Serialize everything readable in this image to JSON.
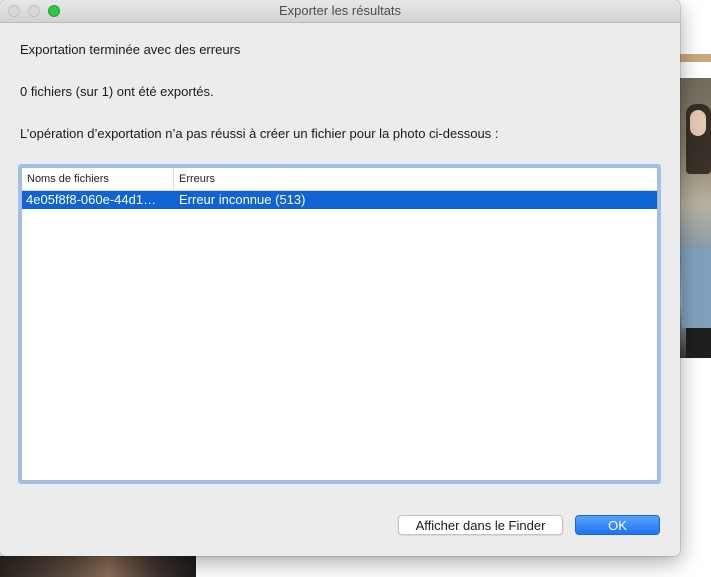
{
  "window": {
    "title": "Exporter les résultats"
  },
  "messages": {
    "summary": "Exportation terminée avec des erreurs",
    "count": "0 fichiers (sur 1) ont été exportés.",
    "detail": "L’opération d’exportation n’a pas réussi à créer un fichier pour la photo ci-dessous :"
  },
  "table": {
    "columns": [
      "Noms de fichiers",
      "Erreurs"
    ],
    "rows": [
      {
        "filename": "4e05f8f8-060e-44d1…",
        "error": "Erreur inconnue (513)",
        "selected": true
      }
    ]
  },
  "buttons": {
    "show_in_finder": "Afficher dans le Finder",
    "ok": "OK"
  },
  "colors": {
    "selection": "#0f63d3",
    "focus_ring": "#9bc2f2",
    "default_button": "#1b74f5",
    "zoom_button": "#2dc740"
  }
}
